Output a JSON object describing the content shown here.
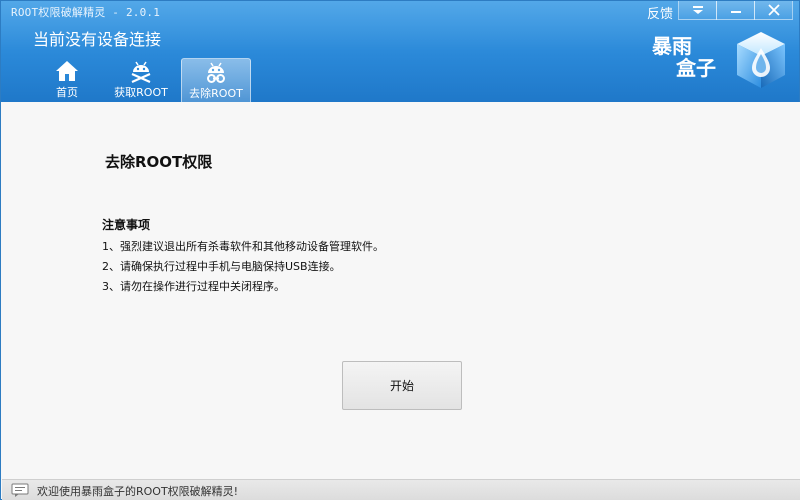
{
  "window": {
    "title": "ROOT权限破解精灵 - 2.0.1",
    "feedback_label": "反馈",
    "controls": [
      "menu",
      "minimize",
      "close"
    ]
  },
  "header": {
    "device_status": "当前没有设备连接",
    "logo_line1": "暴雨",
    "logo_line2": "盒子"
  },
  "tabs": [
    {
      "label": "首页",
      "icon": "home-icon",
      "active": false
    },
    {
      "label": "获取ROOT",
      "icon": "android-root-icon",
      "active": false
    },
    {
      "label": "去除ROOT",
      "icon": "android-unroot-icon",
      "active": true
    }
  ],
  "main": {
    "heading": "去除ROOT权限",
    "notes_title": "注意事项",
    "notes": [
      "1、强烈建议退出所有杀毒软件和其他移动设备管理软件。",
      "2、请确保执行过程中手机与电脑保持USB连接。",
      "3、请勿在操作进行过程中关闭程序。"
    ],
    "start_button": "开始"
  },
  "statusbar": {
    "message": "欢迎使用暴雨盒子的ROOT权限破解精灵!"
  },
  "colors": {
    "header_blue": "#2a88d8",
    "content_bg": "#f7f7f7"
  }
}
